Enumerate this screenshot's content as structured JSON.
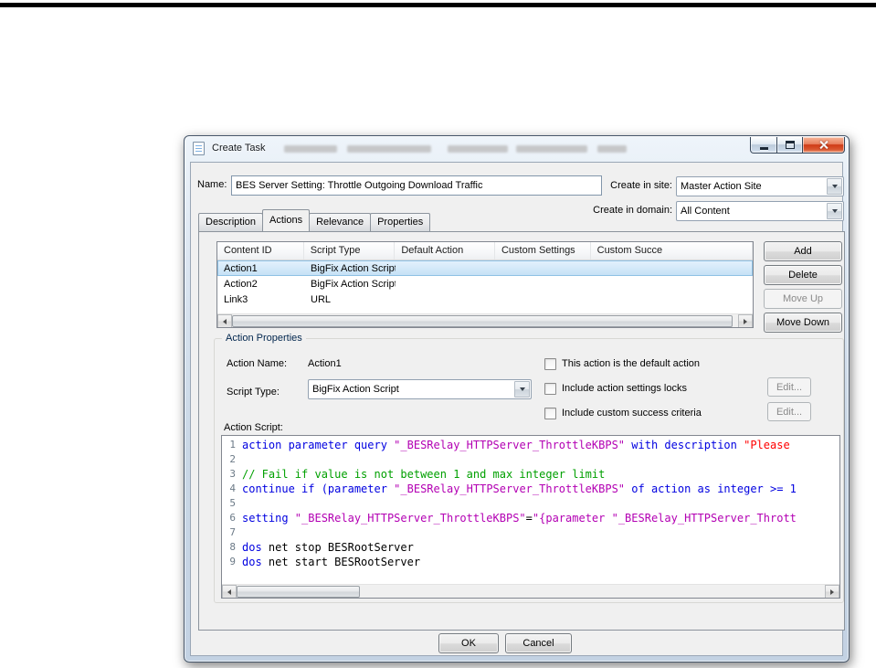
{
  "window": {
    "title": "Create Task"
  },
  "form": {
    "name_label": "Name:",
    "name_value": "BES Server Setting: Throttle Outgoing Download Traffic",
    "site_label": "Create in site:",
    "site_value": "Master Action Site",
    "domain_label": "Create in domain:",
    "domain_value": "All Content"
  },
  "tabs": [
    {
      "label": "Description"
    },
    {
      "label": "Actions"
    },
    {
      "label": "Relevance"
    },
    {
      "label": "Properties"
    }
  ],
  "active_tab": "Actions",
  "actions_table": {
    "columns": [
      "Content ID",
      "Script Type",
      "Default Action",
      "Custom Settings",
      "Custom Succe"
    ],
    "rows": [
      {
        "content_id": "Action1",
        "script_type": "BigFix Action Script",
        "selected": true
      },
      {
        "content_id": "Action2",
        "script_type": "BigFix Action Script",
        "selected": false
      },
      {
        "content_id": "Link3",
        "script_type": "URL",
        "selected": false
      }
    ],
    "selected_row": "Action1"
  },
  "table_buttons": {
    "add": "Add",
    "delete": "Delete",
    "move_up": "Move Up",
    "move_down": "Move Down"
  },
  "action_properties": {
    "group_label": "Action Properties",
    "action_name_label": "Action Name:",
    "action_name_value": "Action1",
    "script_type_label": "Script Type:",
    "script_type_value": "BigFix Action Script",
    "default_action_checkbox": "This action is the default action",
    "settings_locks_checkbox": "Include action settings locks",
    "success_criteria_checkbox": "Include custom success criteria",
    "edit_button": "Edit...",
    "script_label": "Action Script:"
  },
  "editor": {
    "lines": [
      {
        "num": "1",
        "tokens": [
          {
            "c": "kw",
            "t": "action parameter query "
          },
          {
            "c": "str",
            "t": "\"_BESRelay_HTTPServer_ThrottleKBPS\""
          },
          {
            "c": "kw",
            "t": " with description "
          },
          {
            "c": "red",
            "t": "\"Please"
          }
        ]
      },
      {
        "num": "2",
        "tokens": []
      },
      {
        "num": "3",
        "tokens": [
          {
            "c": "cmt",
            "t": "// Fail if value is not between 1 and max integer limit"
          }
        ]
      },
      {
        "num": "4",
        "tokens": [
          {
            "c": "kw",
            "t": "continue if (parameter "
          },
          {
            "c": "str",
            "t": "\"_BESRelay_HTTPServer_ThrottleKBPS\""
          },
          {
            "c": "kw",
            "t": " of action as integer >= 1"
          }
        ]
      },
      {
        "num": "5",
        "tokens": []
      },
      {
        "num": "6",
        "tokens": [
          {
            "c": "kw",
            "t": "setting "
          },
          {
            "c": "str",
            "t": "\"_BESRelay_HTTPServer_ThrottleKBPS\""
          },
          {
            "c": "txt",
            "t": "="
          },
          {
            "c": "str",
            "t": "\"{parameter \"_BESRelay_HTTPServer_Thrott"
          }
        ]
      },
      {
        "num": "7",
        "tokens": []
      },
      {
        "num": "8",
        "tokens": [
          {
            "c": "kw",
            "t": "dos"
          },
          {
            "c": "txt",
            "t": " net stop BESRootServer"
          }
        ]
      },
      {
        "num": "9",
        "tokens": [
          {
            "c": "kw",
            "t": "dos"
          },
          {
            "c": "txt",
            "t": " net start BESRootServer"
          }
        ]
      }
    ]
  },
  "footer": {
    "ok": "OK",
    "cancel": "Cancel"
  },
  "colors": {
    "keyword": "#0000e0",
    "string": "#b300b3",
    "comment": "#00a000",
    "description_string": "#ff0000",
    "selection": "#c4e0f5",
    "close_button": "#cf3a16"
  }
}
